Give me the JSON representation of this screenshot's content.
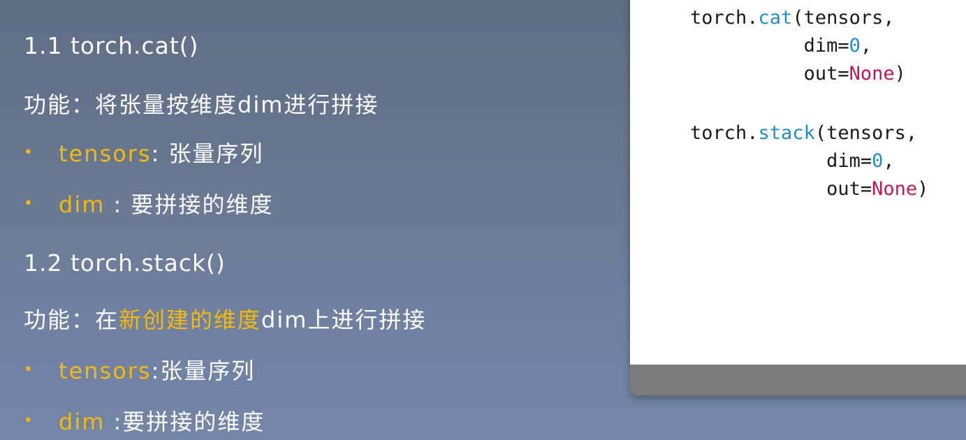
{
  "colors": {
    "highlight": "#f5b90a",
    "function_name": "#1f8fc8",
    "keyword": "#c2185b",
    "number": "#1f8fc8"
  },
  "left": {
    "section1_title": "1.1 torch.cat()",
    "section1_func_label": "功能：将张量按维度dim进行拼接",
    "section1_bullets": [
      {
        "term": "tensors",
        "sep": ": ",
        "desc": "张量序列"
      },
      {
        "term": "dim",
        "sep": " : ",
        "desc": "要拼接的维度"
      }
    ],
    "section2_title": "1.2 torch.stack()",
    "section2_func_prefix": "功能：在",
    "section2_func_highlight": "新创建的维度",
    "section2_func_suffix": "dim上进行拼接",
    "section2_bullets": [
      {
        "term": "tensors",
        "sep": ":",
        "desc": "张量序列"
      },
      {
        "term": "dim",
        "sep": " :",
        "desc": "要拼接的维度"
      }
    ],
    "bullet_glyph": "•"
  },
  "code": {
    "cat": {
      "prefix": "torch.",
      "fn": "cat",
      "line1_rest": "(tensors,",
      "line2_indent": "          ",
      "line2_key": "dim=",
      "line2_val": "0",
      "line2_end": ",",
      "line3_indent": "          ",
      "line3_key": "out=",
      "line3_val": "None",
      "line3_end": ")"
    },
    "stack": {
      "prefix": "torch.",
      "fn": "stack",
      "line1_rest": "(tensors,",
      "line2_indent": "            ",
      "line2_key": "dim=",
      "line2_val": "0",
      "line2_end": ",",
      "line3_indent": "            ",
      "line3_key": "out=",
      "line3_val": "None",
      "line3_end": ")"
    }
  }
}
